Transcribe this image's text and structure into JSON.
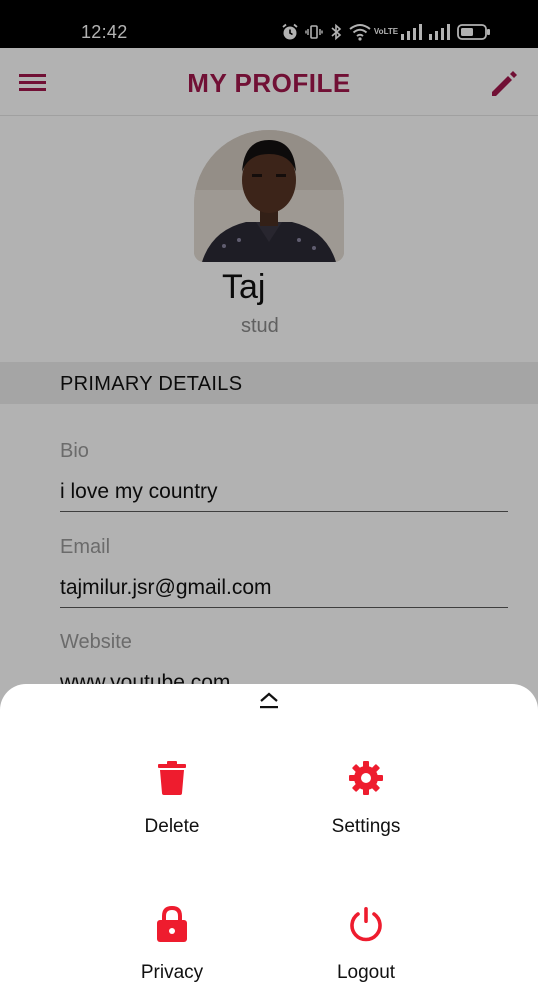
{
  "status_bar": {
    "time": "12:42",
    "icons": [
      "alarm-icon",
      "vibrate-icon",
      "bluetooth-icon",
      "wifi-icon",
      "volte-icon",
      "signal-icon",
      "signal-icon",
      "battery-icon"
    ],
    "volte_top": "Vo",
    "volte_bottom": "LTE"
  },
  "app_bar": {
    "title": "MY PROFILE",
    "menu_icon": "hamburger-menu-icon",
    "edit_icon": "pencil-icon"
  },
  "profile": {
    "name": "Taj",
    "role": "stud"
  },
  "section_title": "PRIMARY DETAILS",
  "fields": [
    {
      "label": "Bio",
      "value": "i love my country"
    },
    {
      "label": "Email",
      "value": "tajmilur.jsr@gmail.com"
    },
    {
      "label": "Website",
      "value": "www.youtube.com"
    }
  ],
  "sheet": {
    "handle_icon": "chevron-up-icon",
    "actions": [
      {
        "label": "Delete",
        "icon": "trash-icon"
      },
      {
        "label": "Settings",
        "icon": "gear-icon"
      },
      {
        "label": "Privacy",
        "icon": "lock-icon"
      },
      {
        "label": "Logout",
        "icon": "power-icon"
      }
    ]
  },
  "colors": {
    "brand": "#a3174c",
    "action_icons": "#ee1c2e",
    "status_bar": "#000000",
    "overlay": "rgba(0,0,0,0.30)"
  }
}
